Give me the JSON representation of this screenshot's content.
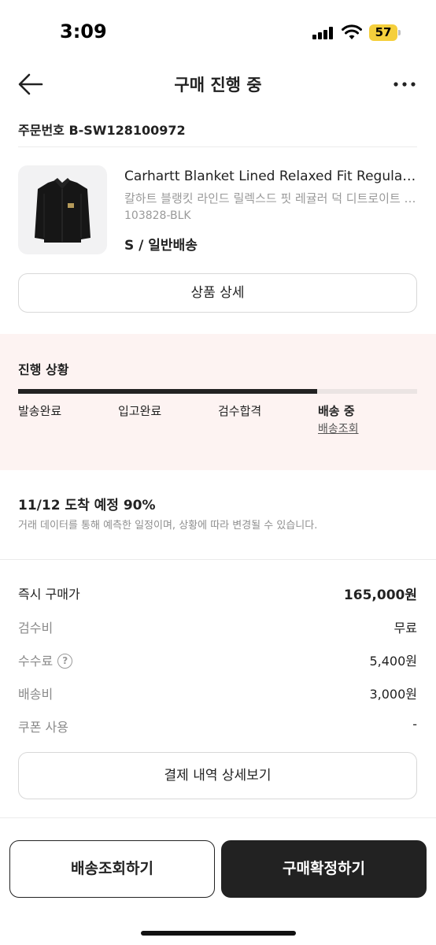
{
  "status_bar": {
    "time": "3:09",
    "battery": "57",
    "battery_color": "#f5cf3c",
    "icons": [
      "cellular-signal-icon",
      "wifi-icon",
      "battery-icon"
    ]
  },
  "header": {
    "title": "구매 진행 중",
    "back_icon": "arrow-left-icon",
    "more_icon": "more-horizontal-icon"
  },
  "order": {
    "number": "주문번호 B-SW128100972"
  },
  "product": {
    "name": "Carhartt Blanket Lined Relaxed Fit Regular Duck Detroit Jacket Black",
    "name_ko": "칼하트 블랭킷 라인드 릴렉스드 핏 레귤러 덕 디트로이트 자켓 블랙",
    "model": "103828-BLK",
    "option": "S / 일반배송",
    "image": "black-jacket-image",
    "detail_button": "상품 상세"
  },
  "progress": {
    "title": "진행 상황",
    "fraction": 0.75,
    "steps": [
      "발송완료",
      "입고완료",
      "검수합격",
      "배송 중"
    ],
    "active_step": 3,
    "tracking_link": "배송조회",
    "background": "#fdf3f2"
  },
  "eta": {
    "title": "11/12 도착 예정 90%",
    "description": "거래 데이터를 통해 예측한 일정이며, 상황에 따라 변경될 수 있습니다."
  },
  "price": {
    "rows": [
      {
        "label": "즉시 구매가",
        "value": "165,000원"
      },
      {
        "label": "검수비",
        "value": "무료"
      },
      {
        "label": "수수료",
        "value": "5,400원"
      },
      {
        "label": "배송비",
        "value": "3,000원"
      },
      {
        "label": "쿠폰 사용",
        "value": "-"
      }
    ],
    "help_icon": "question-circle-icon",
    "help_glyph": "?",
    "payment_details_button": "결제 내역 상세보기"
  },
  "actions": {
    "track_button": "배송조회하기",
    "confirm_button": "구매확정하기"
  }
}
